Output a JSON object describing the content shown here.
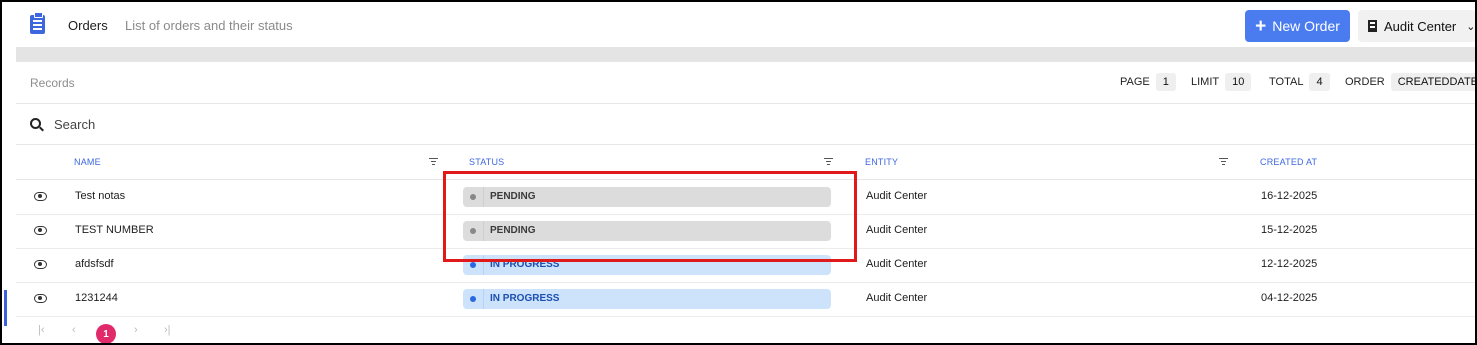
{
  "header": {
    "title": "Orders",
    "subtitle": "List of orders and their status",
    "new_order_label": "New Order",
    "entity_selected": "Audit Center"
  },
  "records": {
    "label": "Records",
    "page_label": "PAGE",
    "page_value": "1",
    "limit_label": "LIMIT",
    "limit_value": "10",
    "total_label": "TOTAL",
    "total_value": "4",
    "order_label": "ORDER",
    "order_value": "CREATEDDATE"
  },
  "search": {
    "placeholder": "Search"
  },
  "table": {
    "columns": [
      "NAME",
      "STATUS",
      "ENTITY",
      "CREATED AT"
    ],
    "rows": [
      {
        "name": "Test notas",
        "status": "PENDING",
        "entity": "Audit Center",
        "created_at": "16-12-2025"
      },
      {
        "name": "TEST NUMBER",
        "status": "PENDING",
        "entity": "Audit Center",
        "created_at": "15-12-2025"
      },
      {
        "name": "afdsfsdf",
        "status": "IN PROGRESS",
        "entity": "Audit Center",
        "created_at": "12-12-2025"
      },
      {
        "name": "1231244",
        "status": "IN PROGRESS",
        "entity": "Audit Center",
        "created_at": "04-12-2025"
      }
    ]
  },
  "pagination": {
    "first": "|‹",
    "prev": "‹",
    "current": "1",
    "next": "›",
    "last": "›|"
  },
  "colors": {
    "accent": "#4a7cf0",
    "pending_bg": "#dcdcdc",
    "in_progress_bg": "#cde3fb",
    "highlight": "#e01a1a",
    "page_current": "#e02a6a"
  }
}
